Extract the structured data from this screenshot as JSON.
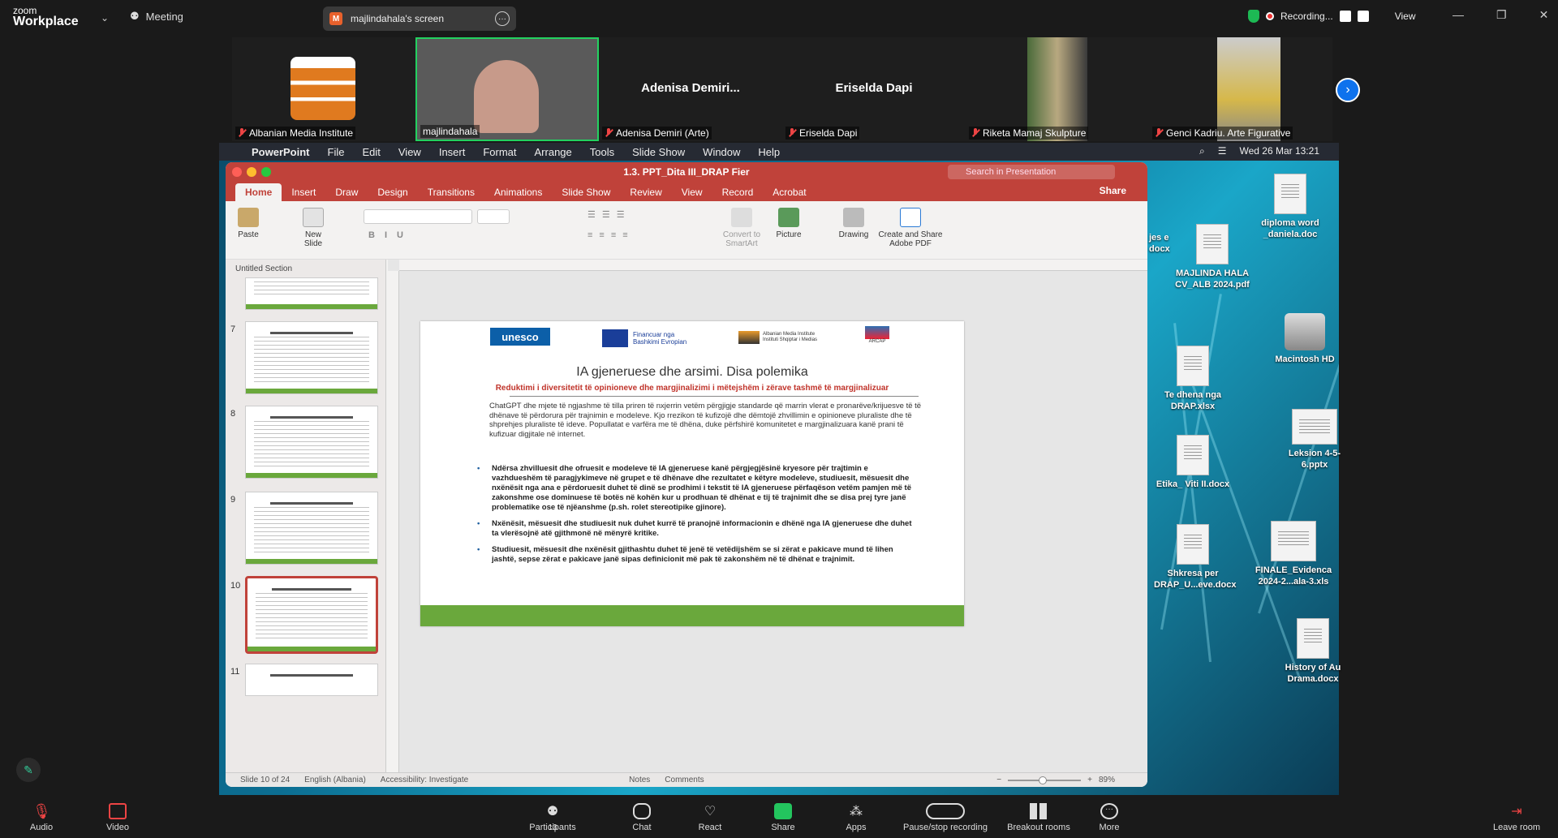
{
  "zoom": {
    "brand_line1": "zoom",
    "brand_line2": "Workplace",
    "meeting_label": "Meeting",
    "share_owner": "majlindahala's screen",
    "share_initial": "M",
    "recording_label": "Recording...",
    "view_label": "View"
  },
  "participants": [
    {
      "name": "Albanian Media Institute",
      "big": ""
    },
    {
      "name": "majlindahala",
      "big": ""
    },
    {
      "name": "Adenisa Demiri (Arte)",
      "big": "Adenisa  Demiri..."
    },
    {
      "name": "Eriselda Dapi",
      "big": "Eriselda Dapi"
    },
    {
      "name": "Riketa Mamaj Skulpture",
      "big": ""
    },
    {
      "name": "Genci Kadriu. Arte Figurative",
      "big": ""
    }
  ],
  "mac_menu": {
    "app": "PowerPoint",
    "items": [
      "File",
      "Edit",
      "View",
      "Insert",
      "Format",
      "Arrange",
      "Tools",
      "Slide Show",
      "Window",
      "Help"
    ],
    "clock": "Wed 26 Mar  13:21"
  },
  "ppt": {
    "title": "1.3. PPT_Dita III_DRAP Fier",
    "search_placeholder": "Search in Presentation",
    "share": "Share",
    "tabs": [
      "Home",
      "Insert",
      "Draw",
      "Design",
      "Transitions",
      "Animations",
      "Slide Show",
      "Review",
      "View",
      "Record",
      "Acrobat"
    ],
    "ribbon": {
      "paste": "Paste",
      "new_slide": "New Slide",
      "convert": "Convert to SmartArt",
      "picture": "Picture",
      "drawing": "Drawing",
      "create_share": "Create and Share Adobe PDF"
    },
    "section": "Untitled Section",
    "thumb_numbers": [
      "7",
      "8",
      "9",
      "10",
      "11"
    ],
    "status": {
      "slide": "Slide 10 of 24",
      "language": "English (Albania)",
      "accessibility": "Accessibility: Investigate",
      "notes": "Notes",
      "comments": "Comments",
      "zoom": "89%"
    }
  },
  "slide": {
    "unesco": "unesco",
    "eu_text": "Financuar nga Bashkimi Evropian",
    "ami_text": "Albanian Media Institute Instituti Shqiptar i Medias",
    "arcap_text": "ARCAP",
    "title": "IA gjeneruese dhe arsimi. Disa polemika",
    "subtitle": "Reduktimi i diversitetit të opinioneve dhe margjinalizimi i mëtejshëm i zërave tashmë të margjinalizuar",
    "intro": "ChatGPT dhe mjete të ngjashme të tilla priren të nxjerrin vetëm përgjigje standarde që marrin vlerat e pronarëve/krijuesve të të dhënave të përdorura për trajnimin e modeleve. Kjo rrezikon të kufizojë dhe dëmtojë zhvillimin e opinioneve pluraliste dhe të shprehjes pluraliste të ideve. Popullatat e varfëra me të dhëna, duke përfshirë komunitetet e margjinalizuara kanë prani të kufizuar digjitale në internet.",
    "bullets": [
      "Ndërsa zhvilluesit dhe ofruesit e modeleve të IA gjeneruese  kanë përgjegjësinë kryesore për trajtimin e vazhdueshëm të paragjykimeve në grupet e të dhënave dhe rezultatet e këtyre modeleve, studiuesit, mësuesit dhe nxënësit nga ana e përdoruesit duhet të dinë se prodhimi i tekstit të IA gjeneruese përfaqëson vetëm pamjen më të zakonshme ose dominuese të botës në kohën kur u prodhuan të dhënat e tij të trajnimit dhe se disa prej tyre janë problematike ose të njëanshme (p.sh. rolet stereotipike gjinore).",
      "Nxënësit, mësuesit dhe studiuesit nuk duhet kurrë të pranojnë informacionin e dhënë nga IA gjeneruese dhe duhet ta vlerësojnë atë  gjithmonë në mënyrë kritike.",
      "Studiuesit, mësuesit dhe nxënësit gjithashtu duhet të jenë të vetëdijshëm se si zërat e pakicave mund të lihen jashtë, sepse zërat e pakicave janë sipas definicionit më pak të zakonshëm në të dhënat e trajnimit."
    ]
  },
  "desktop_icons": [
    {
      "label": "diplomа word _daniela.doc"
    },
    {
      "label": "MAJLINDA HALA CV_ALB 2024.pdf"
    },
    {
      "label": "Macintosh HD"
    },
    {
      "label": "Te dhena nga DRAP.xlsx"
    },
    {
      "label": "Leksion 4-5-6.pptx"
    },
    {
      "label": "Etika_ Viti II.docx"
    },
    {
      "label": "Shkresa per DRAP_U...eve.docx"
    },
    {
      "label": "FINALE_Evidenca 2024-2...ala-3.xls"
    },
    {
      "label": "History of Au Drama.docx"
    },
    {
      "label": "jes e docx"
    }
  ],
  "toolbar": [
    {
      "label": "Audio"
    },
    {
      "label": "Video"
    },
    {
      "label": "Participants",
      "count": "13"
    },
    {
      "label": "Chat"
    },
    {
      "label": "React"
    },
    {
      "label": "Share"
    },
    {
      "label": "Apps"
    },
    {
      "label": "Pause/stop recording"
    },
    {
      "label": "Breakout rooms"
    },
    {
      "label": "More"
    },
    {
      "label": "Leave room"
    }
  ]
}
